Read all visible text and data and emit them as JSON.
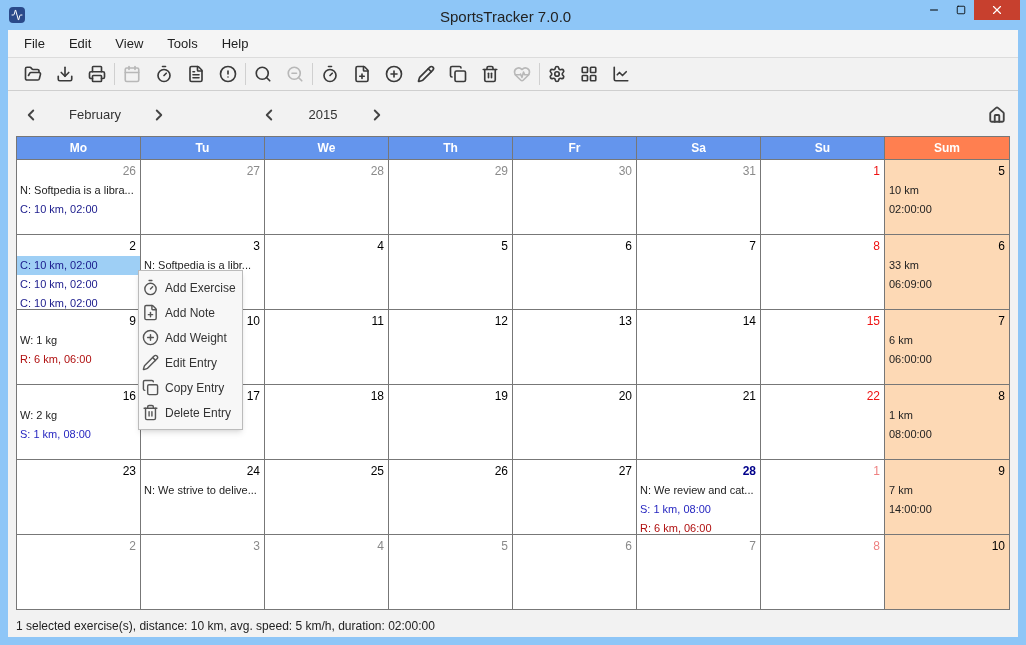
{
  "window": {
    "title": "SportsTracker 7.0.0"
  },
  "menu": [
    "File",
    "Edit",
    "View",
    "Tools",
    "Help"
  ],
  "toolbar": [
    [
      {
        "disabled": false
      },
      {
        "disabled": false
      },
      {
        "disabled": false
      }
    ],
    [
      {
        "disabled": true
      },
      {
        "disabled": false
      },
      {
        "disabled": false
      },
      {
        "disabled": false
      }
    ],
    [
      {
        "disabled": false
      },
      {
        "disabled": true
      }
    ],
    [
      {
        "disabled": false
      },
      {
        "disabled": false
      },
      {
        "disabled": false
      },
      {
        "disabled": false
      },
      {
        "disabled": false
      },
      {
        "disabled": false
      },
      {
        "disabled": true
      }
    ],
    [
      {
        "disabled": false
      },
      {
        "disabled": false
      },
      {
        "disabled": false
      }
    ]
  ],
  "navigation": {
    "month": "February",
    "year": "2015"
  },
  "calendar": {
    "columns": [
      {
        "label": "Mo",
        "kind": "day"
      },
      {
        "label": "Tu",
        "kind": "day"
      },
      {
        "label": "We",
        "kind": "day"
      },
      {
        "label": "Th",
        "kind": "day"
      },
      {
        "label": "Fr",
        "kind": "day"
      },
      {
        "label": "Sa",
        "kind": "day"
      },
      {
        "label": "Su",
        "kind": "day"
      },
      {
        "label": "Sum",
        "kind": "sum"
      }
    ],
    "weeks": [
      {
        "days": [
          {
            "day": "26",
            "kind": "other",
            "entries": [
              {
                "text": "N: Softpedia is a libra...",
                "kind": "note",
                "selected": false
              },
              {
                "text": "C: 10 km, 02:00",
                "kind": "cycling",
                "selected": false
              }
            ]
          },
          {
            "day": "27",
            "kind": "other"
          },
          {
            "day": "28",
            "kind": "other"
          },
          {
            "day": "29",
            "kind": "other"
          },
          {
            "day": "30",
            "kind": "other"
          },
          {
            "day": "31",
            "kind": "other"
          },
          {
            "day": "1",
            "kind": "sunday"
          }
        ],
        "sum": {
          "week": "5",
          "distance": "10 km",
          "duration": "02:00:00"
        }
      },
      {
        "days": [
          {
            "day": "2",
            "kind": "normal",
            "entries": [
              {
                "text": "C: 10 km, 02:00",
                "kind": "cycling",
                "selected": true
              },
              {
                "text": "C: 10 km, 02:00",
                "kind": "cycling",
                "selected": false
              },
              {
                "text": "C: 10 km, 02:00",
                "kind": "cycling",
                "selected": false
              }
            ]
          },
          {
            "day": "3",
            "kind": "normal",
            "entries": [
              {
                "text": "N: Softpedia is a libr...",
                "kind": "note",
                "selected": false
              }
            ]
          },
          {
            "day": "4",
            "kind": "normal"
          },
          {
            "day": "5",
            "kind": "normal"
          },
          {
            "day": "6",
            "kind": "normal"
          },
          {
            "day": "7",
            "kind": "normal"
          },
          {
            "day": "8",
            "kind": "sunday"
          }
        ],
        "sum": {
          "week": "6",
          "distance": "33 km",
          "duration": "06:09:00"
        }
      },
      {
        "days": [
          {
            "day": "9",
            "kind": "normal",
            "entries": [
              {
                "text": "W: 1 kg",
                "kind": "weight",
                "selected": false
              },
              {
                "text": "R: 6 km, 06:00",
                "kind": "running",
                "selected": false
              }
            ]
          },
          {
            "day": "10",
            "kind": "normal"
          },
          {
            "day": "11",
            "kind": "normal"
          },
          {
            "day": "12",
            "kind": "normal"
          },
          {
            "day": "13",
            "kind": "normal"
          },
          {
            "day": "14",
            "kind": "normal"
          },
          {
            "day": "15",
            "kind": "sunday"
          }
        ],
        "sum": {
          "week": "7",
          "distance": "6 km",
          "duration": "06:00:00"
        }
      },
      {
        "days": [
          {
            "day": "16",
            "kind": "normal",
            "entries": [
              {
                "text": "W: 2 kg",
                "kind": "weight",
                "selected": false
              },
              {
                "text": "S: 1 km, 08:00",
                "kind": "swimming",
                "selected": false
              }
            ]
          },
          {
            "day": "17",
            "kind": "normal"
          },
          {
            "day": "18",
            "kind": "normal"
          },
          {
            "day": "19",
            "kind": "normal"
          },
          {
            "day": "20",
            "kind": "normal"
          },
          {
            "day": "21",
            "kind": "normal"
          },
          {
            "day": "22",
            "kind": "sunday"
          }
        ],
        "sum": {
          "week": "8",
          "distance": "1 km",
          "duration": "08:00:00"
        }
      },
      {
        "days": [
          {
            "day": "23",
            "kind": "normal"
          },
          {
            "day": "24",
            "kind": "normal",
            "entries": [
              {
                "text": "N: We strive to delive...",
                "kind": "note",
                "selected": false
              }
            ]
          },
          {
            "day": "25",
            "kind": "normal"
          },
          {
            "day": "26",
            "kind": "normal"
          },
          {
            "day": "27",
            "kind": "normal"
          },
          {
            "day": "28",
            "kind": "today",
            "entries": [
              {
                "text": "N: We review and cat...",
                "kind": "note",
                "selected": false
              },
              {
                "text": "S: 1 km, 08:00",
                "kind": "swimming",
                "selected": false
              },
              {
                "text": "R: 6 km, 06:00",
                "kind": "running",
                "selected": false
              }
            ]
          },
          {
            "day": "1",
            "kind": "other_sunday"
          }
        ],
        "sum": {
          "week": "9",
          "distance": "7 km",
          "duration": "14:00:00"
        }
      },
      {
        "days": [
          {
            "day": "2",
            "kind": "other"
          },
          {
            "day": "3",
            "kind": "other"
          },
          {
            "day": "4",
            "kind": "other"
          },
          {
            "day": "5",
            "kind": "other"
          },
          {
            "day": "6",
            "kind": "other"
          },
          {
            "day": "7",
            "kind": "other"
          },
          {
            "day": "8",
            "kind": "other_sunday"
          }
        ],
        "sum": {
          "week": "10"
        }
      }
    ]
  },
  "context_menu": [
    "Add Exercise",
    "Add Note",
    "Add Weight",
    "Edit Entry",
    "Copy Entry",
    "Delete Entry"
  ],
  "status_bar": "1 selected exercise(s), distance: 10 km, avg. speed: 5 km/h, duration: 02:00:00"
}
